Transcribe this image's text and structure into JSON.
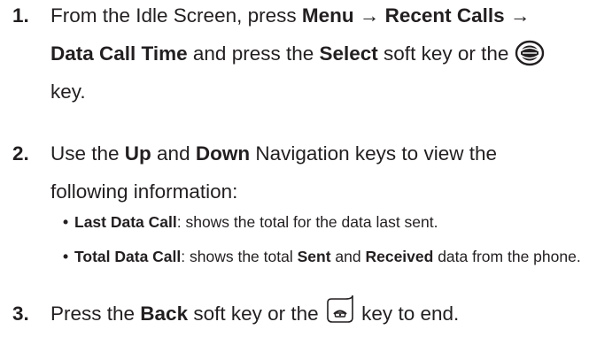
{
  "steps": [
    {
      "number": "1.",
      "line1_a": "From the Idle Screen, press ",
      "line1_b": "Menu",
      "line1_c": " → ",
      "line1_d": "Recent Calls",
      "line1_e": " →",
      "line2_a": "Data Call Time",
      "line2_b": " and press the ",
      "line2_c": "Select",
      "line2_d": " soft key or the ",
      "line3_a": "key.",
      "icon": "ok-nav-key-icon"
    },
    {
      "number": "2.",
      "line1_a": "Use the ",
      "line1_b": "Up",
      "line1_c": " and ",
      "line1_d": "Down",
      "line1_e": " Navigation keys to view the",
      "line2_a": "following information:"
    },
    {
      "number": "3.",
      "line1_a": "Press the ",
      "line1_b": "Back",
      "line1_c": " soft key or the ",
      "line1_d": " key to end.",
      "icon": "end-power-key-icon"
    }
  ],
  "bullets": [
    {
      "bullet": "•",
      "label": "Last Data Call",
      "rest": ": shows the total for the data last sent."
    },
    {
      "bullet": "•",
      "label": "Total Data Call",
      "rest_a": ": shows the total ",
      "bold_a": "Sent",
      "rest_b": " and ",
      "bold_b": "Received",
      "rest_c": " data from the phone."
    }
  ]
}
